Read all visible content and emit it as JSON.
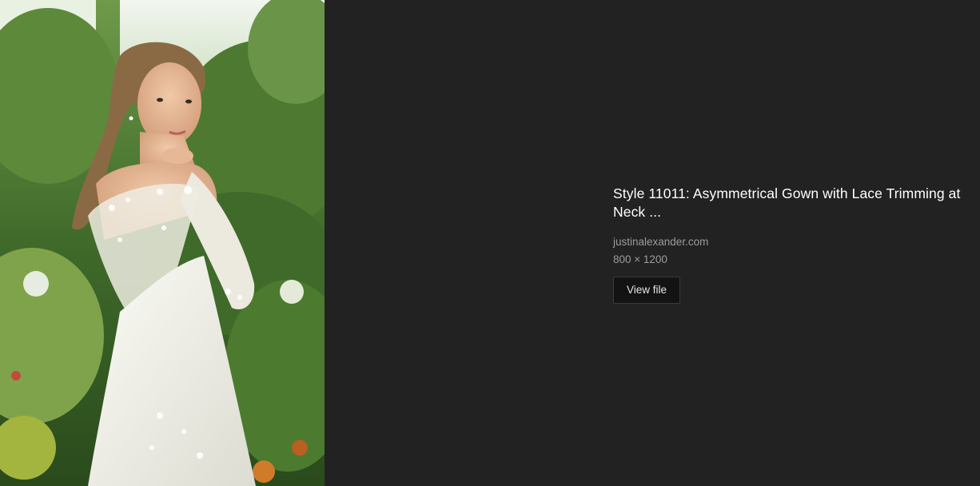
{
  "image": {
    "alt": "Style 11011: Asymmetrical Gown with Lace Trimming at Neck ..."
  },
  "info": {
    "title": "Style 11011: Asymmetrical Gown with Lace Trimming at Neck ...",
    "source": "justinalexander.com",
    "dimensions": "800 × 1200",
    "view_file_label": "View file"
  },
  "colors": {
    "background": "#222222",
    "title_text": "#ffffff",
    "meta_text": "#9c9c9c",
    "button_bg": "#131313"
  }
}
